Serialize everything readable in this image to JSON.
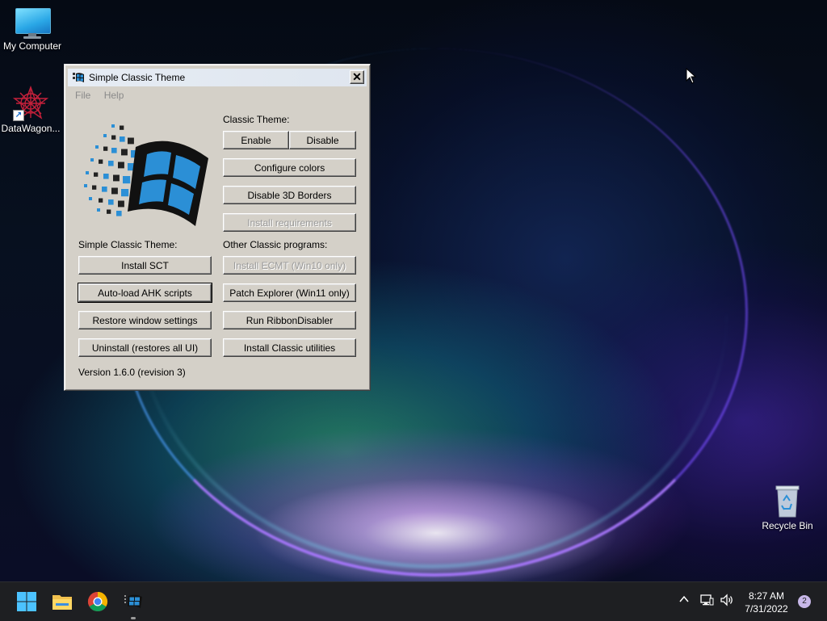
{
  "desktop": {
    "icons": [
      {
        "label": "My Computer",
        "icon": "monitor-icon"
      },
      {
        "label": "DataWagon...",
        "icon": "datawagon-icon"
      },
      {
        "label": "Recycle Bin",
        "icon": "recycle-bin-icon"
      }
    ]
  },
  "window": {
    "title": "Simple Classic Theme",
    "menu": [
      "File",
      "Help"
    ],
    "classic_theme_label": "Classic Theme:",
    "sct_label": "Simple Classic Theme:",
    "other_label": "Other Classic programs:",
    "buttons": {
      "enable": "Enable",
      "disable": "Disable",
      "configure_colors": "Configure colors",
      "disable_3d_borders": "Disable 3D Borders",
      "install_requirements": "Install requirements",
      "install_sct": "Install SCT",
      "install_ecmt": "Install ECMT (Win10 only)",
      "autoload_ahk": "Auto-load AHK scripts",
      "patch_explorer": "Patch Explorer (Win11 only)",
      "restore_window_settings": "Restore window settings",
      "run_ribbondisabler": "Run RibbonDisabler",
      "uninstall": "Uninstall (restores all UI)",
      "install_classic_utilities": "Install Classic utilities"
    },
    "version": "Version 1.6.0 (revision 3)"
  },
  "taskbar": {
    "apps": [
      "start-icon",
      "file-explorer-icon",
      "chrome-icon",
      "simple-classic-theme-icon"
    ],
    "clock": {
      "time": "8:27 AM",
      "date": "7/31/2022"
    },
    "notification_count": "2",
    "tray_icons": [
      "chevron-up-icon",
      "network-icon",
      "volume-icon"
    ]
  },
  "colors": {
    "window_face": "#d4d0c8",
    "taskbar": "#1e1f22",
    "accent_blue": "#2b8fd6"
  }
}
